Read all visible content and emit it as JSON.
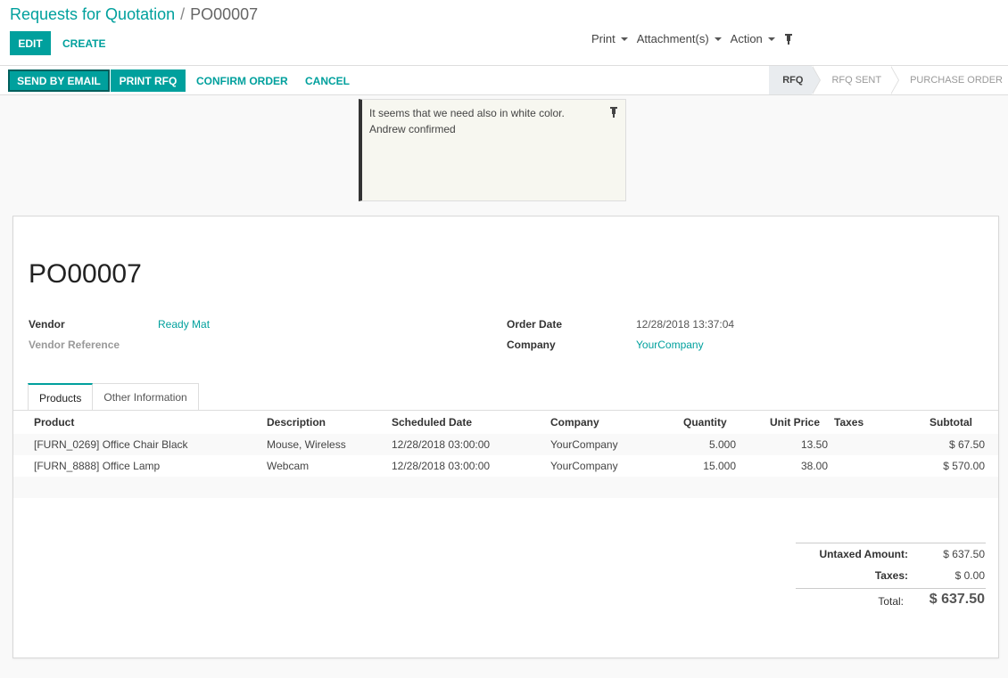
{
  "breadcrumb": {
    "parent": "Requests for Quotation",
    "separator": "/",
    "current": "PO00007"
  },
  "buttons": {
    "edit": "EDIT",
    "create": "CREATE"
  },
  "sidebar": {
    "print": "Print",
    "attachments": "Attachment(s)",
    "action": "Action"
  },
  "statusbar": {
    "send_email": "SEND BY EMAIL",
    "print_rfq": "PRINT RFQ",
    "confirm_order": "CONFIRM ORDER",
    "cancel": "CANCEL",
    "stages": [
      {
        "label": "RFQ",
        "active": true
      },
      {
        "label": "RFQ SENT",
        "active": false
      },
      {
        "label": "PURCHASE ORDER",
        "active": false
      }
    ]
  },
  "note": {
    "line1": "It seems that we need also in white color.",
    "line2": "Andrew confirmed"
  },
  "form": {
    "title": "PO00007",
    "vendor_label": "Vendor",
    "vendor_value": "Ready Mat",
    "vendor_ref_label": "Vendor Reference",
    "order_date_label": "Order Date",
    "order_date_value": "12/28/2018 13:37:04",
    "company_label": "Company",
    "company_value": "YourCompany"
  },
  "tabs": [
    "Products",
    "Other Information"
  ],
  "table": {
    "headers": [
      "Product",
      "Description",
      "Scheduled Date",
      "Company",
      "Quantity",
      "Unit Price",
      "Taxes",
      "Subtotal"
    ],
    "rows": [
      [
        "[FURN_0269] Office Chair Black",
        "Mouse, Wireless",
        "12/28/2018 03:00:00",
        "YourCompany",
        "5.000",
        "13.50",
        "",
        "$ 67.50"
      ],
      [
        "[FURN_8888] Office Lamp",
        "Webcam",
        "12/28/2018 03:00:00",
        "YourCompany",
        "15.000",
        "38.00",
        "",
        "$ 570.00"
      ]
    ]
  },
  "totals": {
    "untaxed_label": "Untaxed Amount:",
    "untaxed_value": "$ 637.50",
    "taxes_label": "Taxes:",
    "taxes_value": "$ 0.00",
    "total_label": "Total:",
    "total_value": "$ 637.50"
  },
  "colors": {
    "accent": "#00a09d"
  }
}
